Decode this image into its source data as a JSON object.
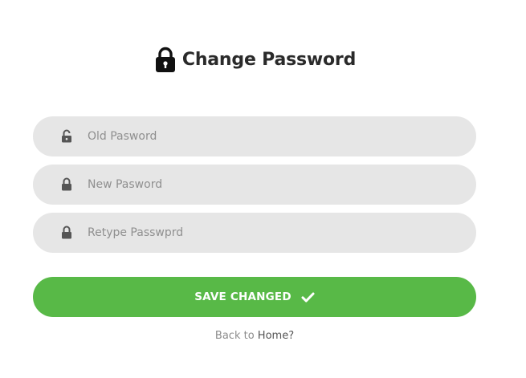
{
  "header": {
    "icon": "lock-icon",
    "title": "Change Password"
  },
  "form": {
    "fields": [
      {
        "icon": "unlock-icon",
        "placeholder": "Old Pasword",
        "value": ""
      },
      {
        "icon": "lock-icon",
        "placeholder": "New Pasword",
        "value": ""
      },
      {
        "icon": "lock-icon",
        "placeholder": "Retype Passwprd",
        "value": ""
      }
    ],
    "submit": {
      "label": "SAVE CHANGED",
      "icon": "checkmark-icon"
    }
  },
  "footer": {
    "prefix": "Back to",
    "link": "Home?"
  },
  "colors": {
    "accent": "#58b947",
    "field_background": "#e6e6e6",
    "title_text": "#2a2a2a"
  }
}
